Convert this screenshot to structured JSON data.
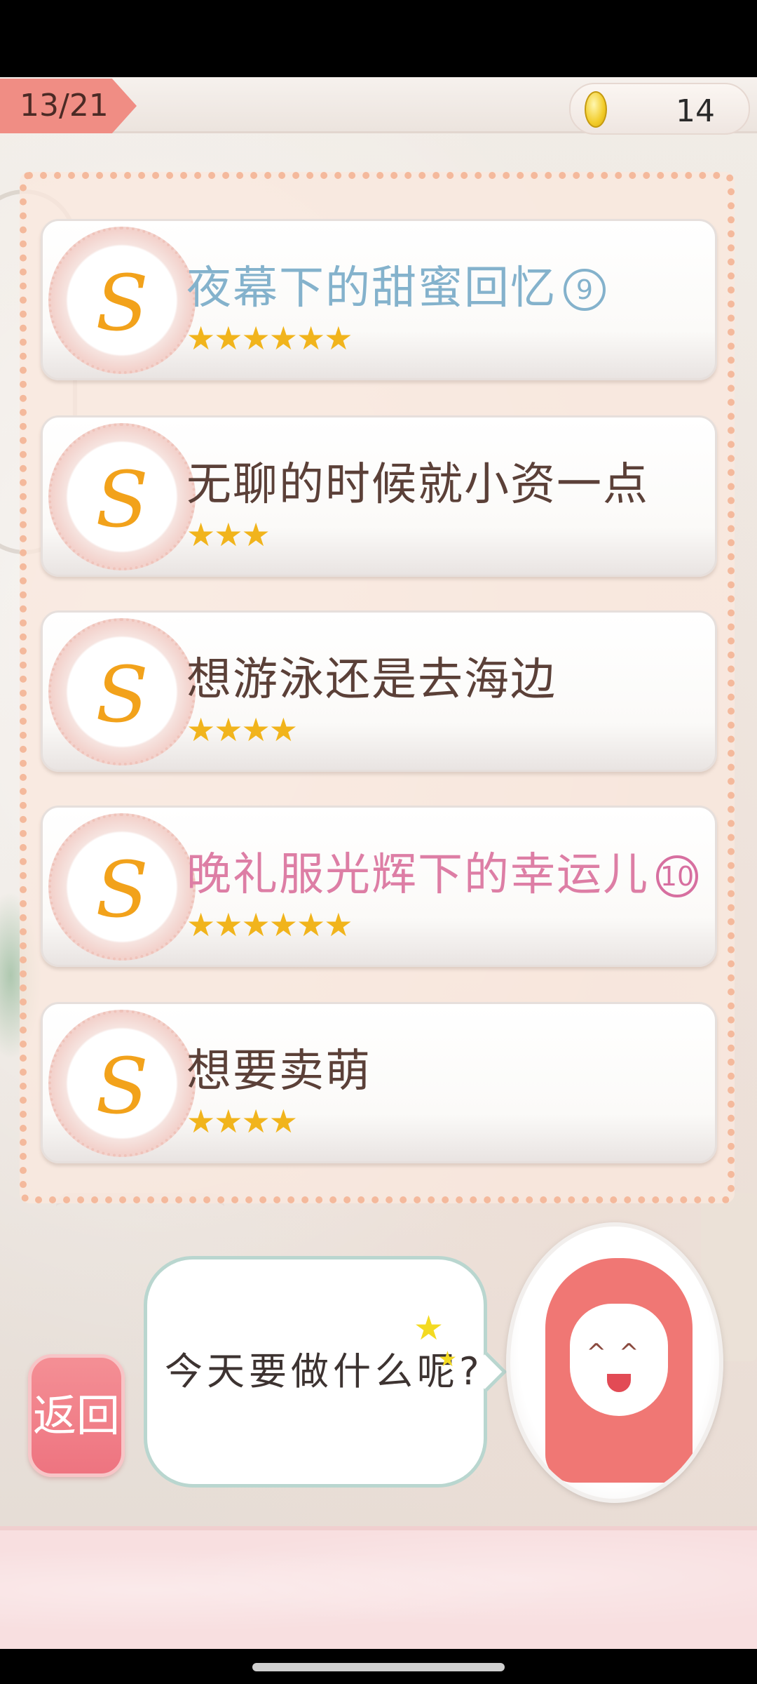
{
  "header": {
    "progress": "13/21",
    "coins": "14"
  },
  "items": [
    {
      "title": "夜幕下的甜蜜回忆",
      "badge": "9",
      "stars": "★★★★★★",
      "star_count": 6,
      "color": "#84b2cc"
    },
    {
      "title": "无聊的时候就小资一点",
      "badge": "",
      "stars": "★★★",
      "star_count": 3,
      "color": "#5b4038"
    },
    {
      "title": "想游泳还是去海边",
      "badge": "",
      "stars": "★★★★",
      "star_count": 4,
      "color": "#5b4038"
    },
    {
      "title": "晚礼服光辉下的幸运儿",
      "badge": "10",
      "stars": "★★★★★★",
      "star_count": 6,
      "color": "#dd7ea5"
    },
    {
      "title": "想要卖萌",
      "badge": "",
      "stars": "★★★★",
      "star_count": 4,
      "color": "#5b4038"
    }
  ],
  "medal_glyph": "S",
  "footer": {
    "back_label": "返回",
    "bubble_text": "今天要做什么呢?"
  }
}
